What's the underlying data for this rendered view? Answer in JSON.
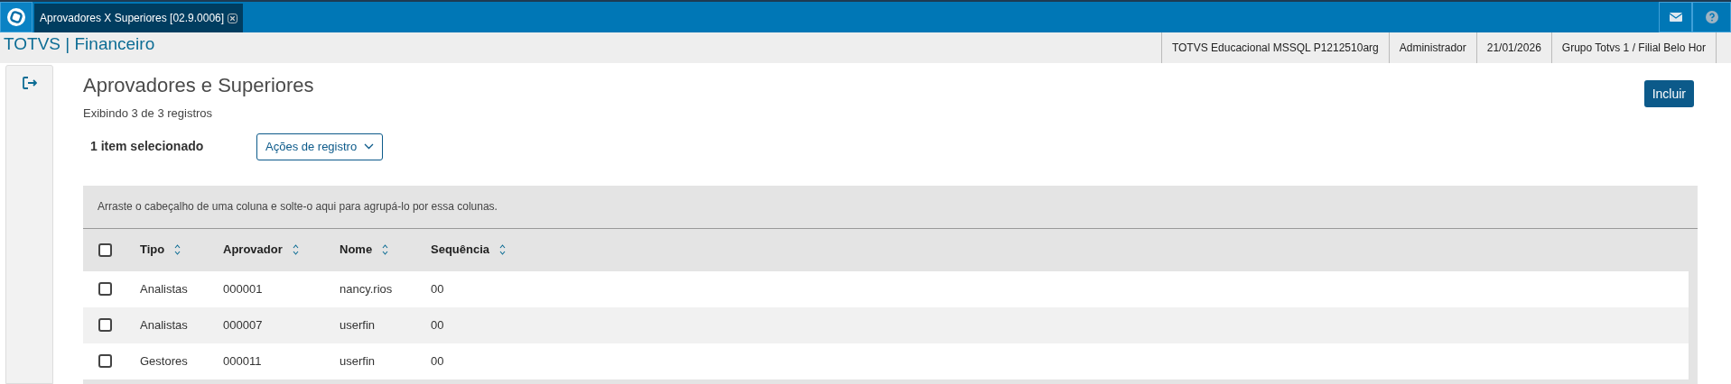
{
  "tabs": [
    {
      "label": "Aprovadores X Superiores [02.9.0006]",
      "selected": true
    }
  ],
  "app_title": "TOTVS | Financeiro",
  "status_cells": [
    "TOTVS Educacional MSSQL P1212510arg",
    "Administrador",
    "21/01/2026",
    "Grupo Totvs 1 / Filial Belo Hor"
  ],
  "page": {
    "title": "Aprovadores e Superiores",
    "subtitle": "Exibindo 3 de 3 registros",
    "add_button": "Incluir",
    "selection_count": "1 item selecionado",
    "actions_dropdown": "Ações de registro"
  },
  "grid": {
    "group_hint": "Arraste o cabeçalho de uma coluna e solte-o aqui para agrupá-lo por essa colunas.",
    "select_all_checked": false,
    "columns": [
      "Tipo",
      "Aprovador",
      "Nome",
      "Sequência"
    ],
    "rows": [
      {
        "checked": false,
        "cells": [
          "Analistas",
          "000001",
          "nancy.rios",
          "00"
        ]
      },
      {
        "checked": false,
        "cells": [
          "Analistas",
          "000007",
          "userfin",
          "00"
        ]
      },
      {
        "checked": false,
        "cells": [
          "Gestores",
          "000011",
          "userfin",
          "00"
        ]
      }
    ]
  }
}
